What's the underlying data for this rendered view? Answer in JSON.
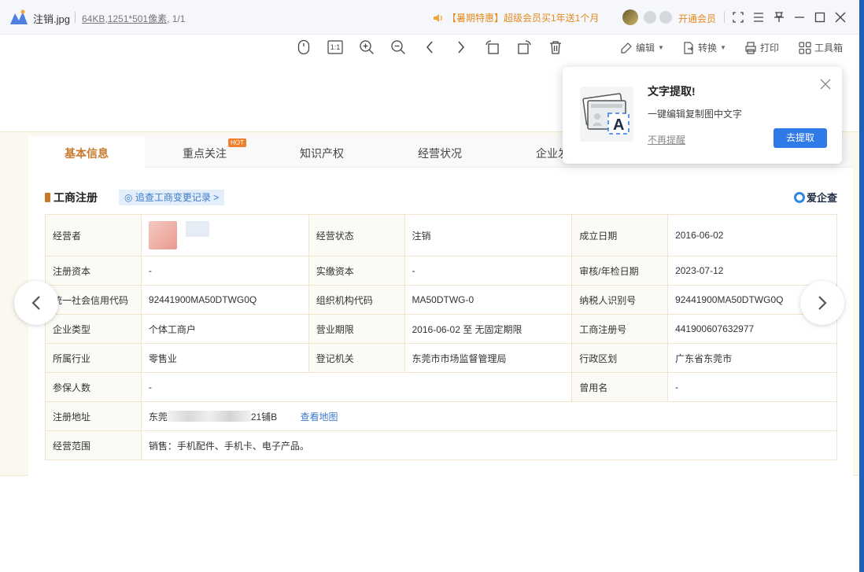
{
  "titlebar": {
    "file_name": "注销.jpg",
    "file_size": "64KB",
    "comma": ",",
    "dimensions": "1251*501像素",
    "page_count": ", 1/1",
    "promo": "【暑期特惠】超级会员买1年送1个月",
    "vip_link": "开通会员"
  },
  "toolbar": {
    "edit_label": "编辑",
    "convert_label": "转换",
    "print_label": "打印",
    "toolbox_label": "工具箱",
    "actual_size_label": "1:1"
  },
  "tabs": [
    {
      "label": "基本信息",
      "active": true
    },
    {
      "label": "重点关注",
      "badge": "HOT"
    },
    {
      "label": "知识产权"
    },
    {
      "label": "经营状况"
    },
    {
      "label": "企业发"
    }
  ],
  "section": {
    "title": "工商注册",
    "trace_link": "追查工商变更记录 >",
    "brand": "爱企查"
  },
  "table": {
    "operator_label": "经营者",
    "status_label": "经营状态",
    "status_value": "注销",
    "founded_label": "成立日期",
    "founded_value": "2016-06-02",
    "capital_label": "注册资本",
    "capital_value": "-",
    "paid_capital_label": "实缴资本",
    "paid_capital_value": "-",
    "review_date_label": "审核/年检日期",
    "review_date_value": "2023-07-12",
    "credit_code_label": "统一社会信用代码",
    "credit_code_value": "92441900MA50DTWG0Q",
    "org_code_label": "组织机构代码",
    "org_code_value": "MA50DTWG-0",
    "taxpayer_label": "纳税人识别号",
    "taxpayer_value": "92441900MA50DTWG0Q",
    "company_type_label": "企业类型",
    "company_type_value": "个体工商户",
    "term_label": "营业期限",
    "term_value": "2016-06-02 至 无固定期限",
    "reg_no_label": "工商注册号",
    "reg_no_value": "441900607632977",
    "industry_label": "所属行业",
    "industry_value": "零售业",
    "authority_label": "登记机关",
    "authority_value": "东莞市市场监督管理局",
    "region_label": "行政区划",
    "region_value": "广东省东莞市",
    "insured_label": "参保人数",
    "insured_value": "-",
    "former_name_label": "曾用名",
    "former_name_value": "-",
    "address_label": "注册地址",
    "address_prefix": "东莞",
    "address_suffix": "21铺B",
    "map_link": "查看地图",
    "scope_label": "经营范围",
    "scope_value": "销售：手机配件、手机卡、电子产品。"
  },
  "popup": {
    "title": "文字提取!",
    "description": "一键编辑复制图中文字",
    "skip": "不再提醒",
    "action": "去提取"
  },
  "colors": {
    "accent": "#c87a2b",
    "link": "#3c7ac8",
    "promo": "#e58a1f",
    "primary_button": "#2f7ae6"
  }
}
